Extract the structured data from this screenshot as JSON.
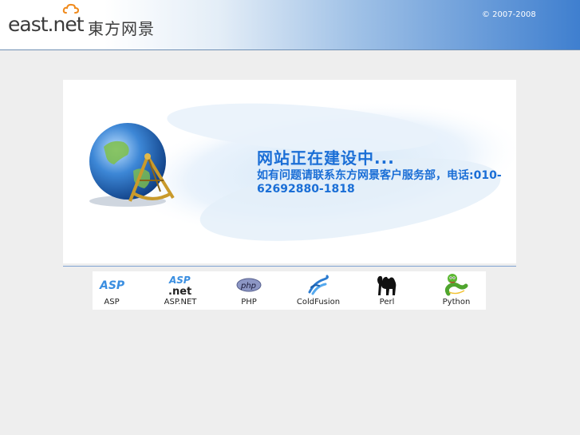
{
  "header": {
    "logo_text": "east.net",
    "logo_cn": "東方网景",
    "copyright": "© 2007-2008"
  },
  "message": {
    "title": "网站正在建设中...",
    "body": "如有问题请联系东方网景客户服务部，电话:010-62692880-1818"
  },
  "technologies": [
    {
      "label": "ASP",
      "icon": "asp-icon"
    },
    {
      "label": "ASP.NET",
      "icon": "aspnet-icon"
    },
    {
      "label": "PHP",
      "icon": "php-icon"
    },
    {
      "label": "ColdFusion",
      "icon": "coldfusion-icon"
    },
    {
      "label": "Perl",
      "icon": "perl-camel-icon"
    },
    {
      "label": "Python",
      "icon": "python-snake-icon"
    }
  ],
  "colors": {
    "accent": "#1a6ed6",
    "header_blue": "#3f7fcf",
    "background": "#eeeeee"
  }
}
